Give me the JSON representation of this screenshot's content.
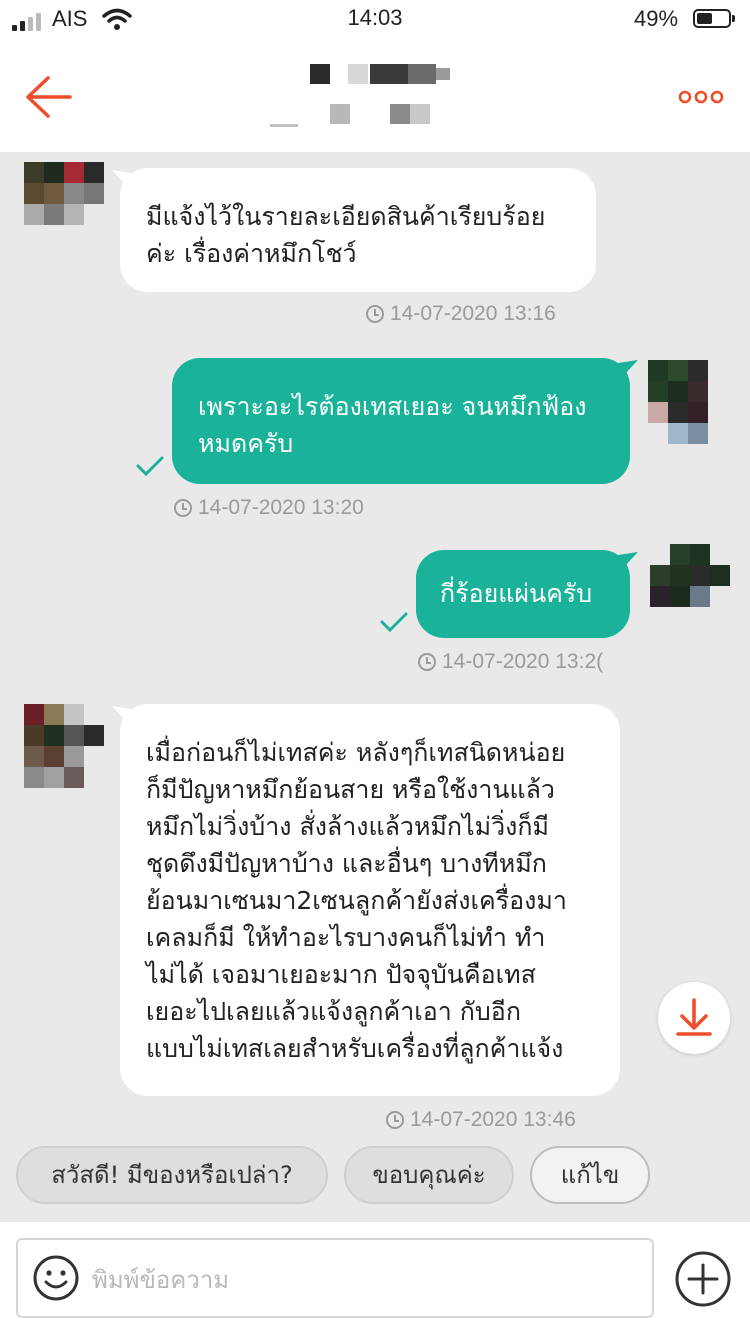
{
  "status_bar": {
    "carrier": "AIS",
    "time": "14:03",
    "battery_percent": "49%",
    "battery_level": 0.49
  },
  "header": {
    "back_icon": "arrow-left-icon",
    "more_icon": "more-dots-icon",
    "accent_color": "#ee4d2d"
  },
  "messages": [
    {
      "side": "in",
      "lines": [
        "มีแจ้งไว้ในรายละเอียดสินค้าเรียบร้อย",
        "ค่ะ เรื่องค่าหมึกโชว์"
      ],
      "time": "14-07-2020 13:16"
    },
    {
      "side": "out",
      "lines": [
        "เพราะอะไรต้องเทสเยอะ จนหมึกฟ้อง",
        "หมดครับ"
      ],
      "time": "14-07-2020 13:20"
    },
    {
      "side": "out",
      "lines": [
        "กี่ร้อยแผ่นครับ"
      ],
      "time": "14-07-2020 13:2("
    },
    {
      "side": "in",
      "lines": [
        "เมื่อก่อนก็ไม่เทสค่ะ หลังๆก็เทสนิดหน่อย",
        "ก็มีปัญหาหมึกย้อนสาย หรือใช้งานแล้ว",
        "หมึกไม่วิ่งบ้าง สั่งล้างแล้วหมึกไม่วิ่งก็มี",
        "ชุดดึงมีปัญหาบ้าง และอื่นๆ บางทีหมึก",
        "ย้อนมาเซนมา2เซนลูกค้ายังส่งเครื่องมา",
        "เคลมก็มี ให้ทำอะไรบางคนก็ไม่ทำ ทำ",
        "ไม่ได้ เจอมาเยอะมาก ปัจจุบันคือเทส",
        "เยอะไปเลยแล้วแจ้งลูกค้าเอา กับอีก",
        "แบบไม่เทสเลยสำหรับเครื่องที่ลูกค้าแจ้ง"
      ],
      "time": "14-07-2020 13:46"
    }
  ],
  "quick_replies": [
    "สวัสดี! มีของหรือเปล่า?",
    "ขอบคุณค่ะ",
    "แก้ไข"
  ],
  "input": {
    "placeholder": "พิมพ์ข้อความ"
  },
  "colors": {
    "outgoing_bubble": "#1ab399",
    "incoming_bubble": "#ffffff",
    "chat_background": "#e9e9e9"
  }
}
